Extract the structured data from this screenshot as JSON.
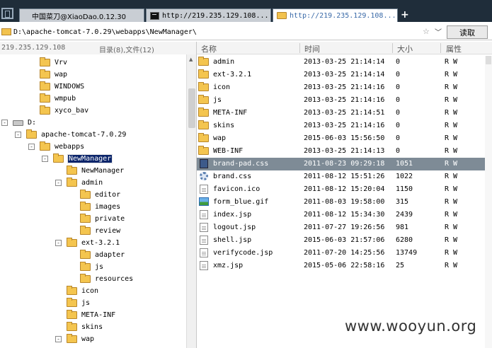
{
  "tabs": [
    {
      "label": "中国菜刀@XiaoDao.0.12.30",
      "icon": "none",
      "active": false
    },
    {
      "label": "http://219.235.129.108...",
      "icon": "terminal-icon",
      "active": false
    },
    {
      "label": "http://219.235.129.108...",
      "icon": "folder-icon",
      "active": true
    }
  ],
  "new_tab_label": "+",
  "address": {
    "path": "D:\\apache-tomcat-7.0.29\\webapps\\NewManager\\",
    "star_glyph": "☆",
    "dropdown_glyph": "﹀",
    "read_button": "读取"
  },
  "left_panel": {
    "host": "219.235.129.108",
    "count_label": "目录(8),文件(12)"
  },
  "tree": [
    {
      "label": "Vrv",
      "level": 2,
      "toggle": "",
      "icon": "folder"
    },
    {
      "label": "wap",
      "level": 2,
      "toggle": "",
      "icon": "folder"
    },
    {
      "label": "WINDOWS",
      "level": 2,
      "toggle": "",
      "icon": "folder"
    },
    {
      "label": "wmpub",
      "level": 2,
      "toggle": "",
      "icon": "folder"
    },
    {
      "label": "xyco_bav",
      "level": 2,
      "toggle": "",
      "icon": "folder"
    },
    {
      "label": "D:",
      "level": 0,
      "toggle": "-",
      "icon": "drive"
    },
    {
      "label": "apache-tomcat-7.0.29",
      "level": 1,
      "toggle": "-",
      "icon": "folder"
    },
    {
      "label": "webapps",
      "level": 2,
      "toggle": "-",
      "icon": "folder"
    },
    {
      "label": "NewManager",
      "level": 3,
      "toggle": "-",
      "icon": "folder",
      "selected": true
    },
    {
      "label": "NewManager",
      "level": 4,
      "toggle": "",
      "icon": "folder"
    },
    {
      "label": "admin",
      "level": 4,
      "toggle": "-",
      "icon": "folder"
    },
    {
      "label": "editor",
      "level": 5,
      "toggle": "",
      "icon": "folder"
    },
    {
      "label": "images",
      "level": 5,
      "toggle": "",
      "icon": "folder"
    },
    {
      "label": "private",
      "level": 5,
      "toggle": "",
      "icon": "folder"
    },
    {
      "label": "review",
      "level": 5,
      "toggle": "",
      "icon": "folder"
    },
    {
      "label": "ext-3.2.1",
      "level": 4,
      "toggle": "-",
      "icon": "folder"
    },
    {
      "label": "adapter",
      "level": 5,
      "toggle": "",
      "icon": "folder"
    },
    {
      "label": "js",
      "level": 5,
      "toggle": "",
      "icon": "folder"
    },
    {
      "label": "resources",
      "level": 5,
      "toggle": "",
      "icon": "folder"
    },
    {
      "label": "icon",
      "level": 4,
      "toggle": "",
      "icon": "folder"
    },
    {
      "label": "js",
      "level": 4,
      "toggle": "",
      "icon": "folder"
    },
    {
      "label": "META-INF",
      "level": 4,
      "toggle": "",
      "icon": "folder"
    },
    {
      "label": "skins",
      "level": 4,
      "toggle": "",
      "icon": "folder"
    },
    {
      "label": "wap",
      "level": 4,
      "toggle": "-",
      "icon": "folder"
    }
  ],
  "columns": {
    "name": "名称",
    "time": "时间",
    "size": "大小",
    "attr": "属性"
  },
  "files": [
    {
      "name": "admin",
      "time": "2013-03-25 21:14:14",
      "size": "0",
      "attr": "R W",
      "icon": "folder-icon"
    },
    {
      "name": "ext-3.2.1",
      "time": "2013-03-25 21:14:14",
      "size": "0",
      "attr": "R W",
      "icon": "folder-icon"
    },
    {
      "name": "icon",
      "time": "2013-03-25 21:14:16",
      "size": "0",
      "attr": "R W",
      "icon": "folder-icon"
    },
    {
      "name": "js",
      "time": "2013-03-25 21:14:16",
      "size": "0",
      "attr": "R W",
      "icon": "folder-icon"
    },
    {
      "name": "META-INF",
      "time": "2013-03-25 21:14:51",
      "size": "0",
      "attr": "R W",
      "icon": "folder-icon"
    },
    {
      "name": "skins",
      "time": "2013-03-25 21:14:16",
      "size": "0",
      "attr": "R W",
      "icon": "folder-icon"
    },
    {
      "name": "wap",
      "time": "2015-06-03 15:56:50",
      "size": "0",
      "attr": "R W",
      "icon": "folder-icon"
    },
    {
      "name": "WEB-INF",
      "time": "2013-03-25 21:14:13",
      "size": "0",
      "attr": "R W",
      "icon": "folder-icon"
    },
    {
      "name": "brand-pad.css",
      "time": "2011-08-23 09:29:18",
      "size": "1051",
      "attr": "R W",
      "icon": "css-file-icon",
      "selected": true
    },
    {
      "name": "brand.css",
      "time": "2011-08-12 15:51:26",
      "size": "1022",
      "attr": "R W",
      "icon": "gear-file-icon"
    },
    {
      "name": "favicon.ico",
      "time": "2011-08-12 15:20:04",
      "size": "1150",
      "attr": "R W",
      "icon": "document-icon"
    },
    {
      "name": "form_blue.gif",
      "time": "2011-08-03 19:58:00",
      "size": "315",
      "attr": "R W",
      "icon": "image-file-icon"
    },
    {
      "name": "index.jsp",
      "time": "2011-08-12 15:34:30",
      "size": "2439",
      "attr": "R W",
      "icon": "document-icon"
    },
    {
      "name": "logout.jsp",
      "time": "2011-07-27 19:26:56",
      "size": "981",
      "attr": "R W",
      "icon": "document-icon"
    },
    {
      "name": "shell.jsp",
      "time": "2015-06-03 21:57:06",
      "size": "6280",
      "attr": "R W",
      "icon": "document-icon"
    },
    {
      "name": "verifycode.jsp",
      "time": "2011-07-20 14:25:56",
      "size": "13749",
      "attr": "R W",
      "icon": "document-icon"
    },
    {
      "name": "xmz.jsp",
      "time": "2015-05-06 22:58:16",
      "size": "25",
      "attr": "R W",
      "icon": "document-icon"
    }
  ],
  "watermark": "www.wooyun.org",
  "colors": {
    "tabbar": "#1f2d3a",
    "selection_row": "#7e8b96",
    "tree_selection": "#0a246a",
    "folder": "#f4c54f"
  }
}
